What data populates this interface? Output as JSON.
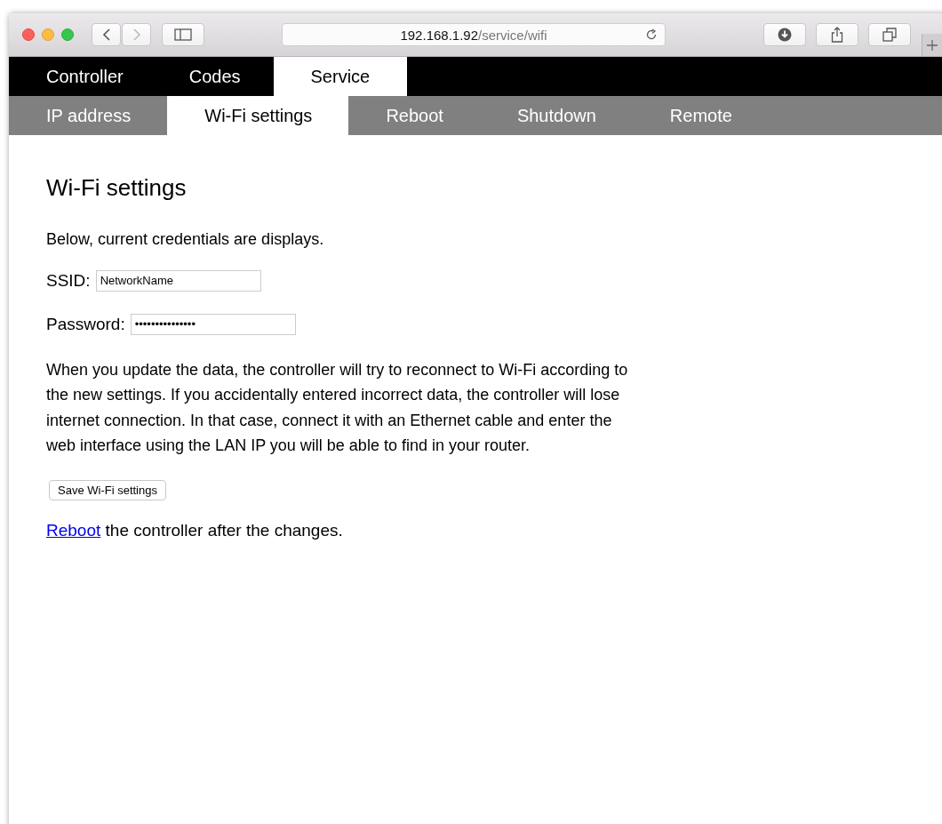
{
  "browser": {
    "url_host": "192.168.1.92",
    "url_path": "/service/wifi"
  },
  "tabs": [
    {
      "label": "Controller",
      "selected": false
    },
    {
      "label": "Codes",
      "selected": false
    },
    {
      "label": "Service",
      "selected": true
    }
  ],
  "subtabs": [
    {
      "label": "IP address",
      "selected": false
    },
    {
      "label": "Wi-Fi settings",
      "selected": true
    },
    {
      "label": "Reboot",
      "selected": false
    },
    {
      "label": "Shutdown",
      "selected": false
    },
    {
      "label": "Remote",
      "selected": false
    }
  ],
  "heading": "Wi-Fi settings",
  "intro": "Below, current credentials are displays.",
  "fields": [
    {
      "label": "SSID:",
      "value": "NetworkName"
    },
    {
      "label": "Password:",
      "value": "•••••••••••••••"
    }
  ],
  "description": "When you update the data, the controller will try to reconnect to Wi-Fi according to the new settings. If you accidentally entered incorrect data, the controller will lose internet connection. In that case, connect it with an Ethernet cable and enter the web interface using the LAN IP you will be able to find in your router.",
  "save_button": "Save Wi-Fi settings",
  "footer": {
    "link": "Reboot",
    "text": " the controller after the changes."
  }
}
